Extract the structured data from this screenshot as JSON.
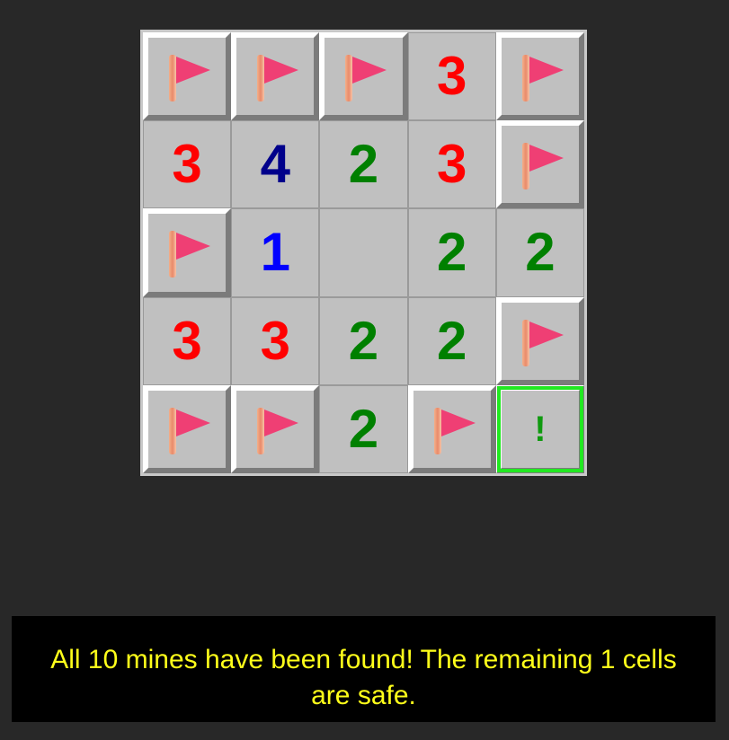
{
  "board": {
    "rows": 5,
    "cols": 5,
    "cells": [
      [
        {
          "state": "flag"
        },
        {
          "state": "flag"
        },
        {
          "state": "flag"
        },
        {
          "state": "number",
          "value": "3"
        },
        {
          "state": "flag"
        }
      ],
      [
        {
          "state": "number",
          "value": "3"
        },
        {
          "state": "number",
          "value": "4"
        },
        {
          "state": "number",
          "value": "2"
        },
        {
          "state": "number",
          "value": "3"
        },
        {
          "state": "flag"
        }
      ],
      [
        {
          "state": "flag"
        },
        {
          "state": "number",
          "value": "1"
        },
        {
          "state": "empty"
        },
        {
          "state": "number",
          "value": "2"
        },
        {
          "state": "number",
          "value": "2"
        }
      ],
      [
        {
          "state": "number",
          "value": "3"
        },
        {
          "state": "number",
          "value": "3"
        },
        {
          "state": "number",
          "value": "2"
        },
        {
          "state": "number",
          "value": "2"
        },
        {
          "state": "flag"
        }
      ],
      [
        {
          "state": "flag"
        },
        {
          "state": "flag"
        },
        {
          "state": "number",
          "value": "2"
        },
        {
          "state": "flag"
        },
        {
          "state": "marked",
          "value": "!",
          "highlight": true
        }
      ]
    ]
  },
  "colors": {
    "number_1": "#0000ff",
    "number_2": "#008000",
    "number_3": "#ff0000",
    "number_4": "#00008b",
    "flag": "#ef3f74",
    "highlight": "#22e822",
    "message_text": "#ffff1a"
  },
  "message": {
    "text": "All 10 mines have been found! The remaining 1 cells are safe."
  }
}
